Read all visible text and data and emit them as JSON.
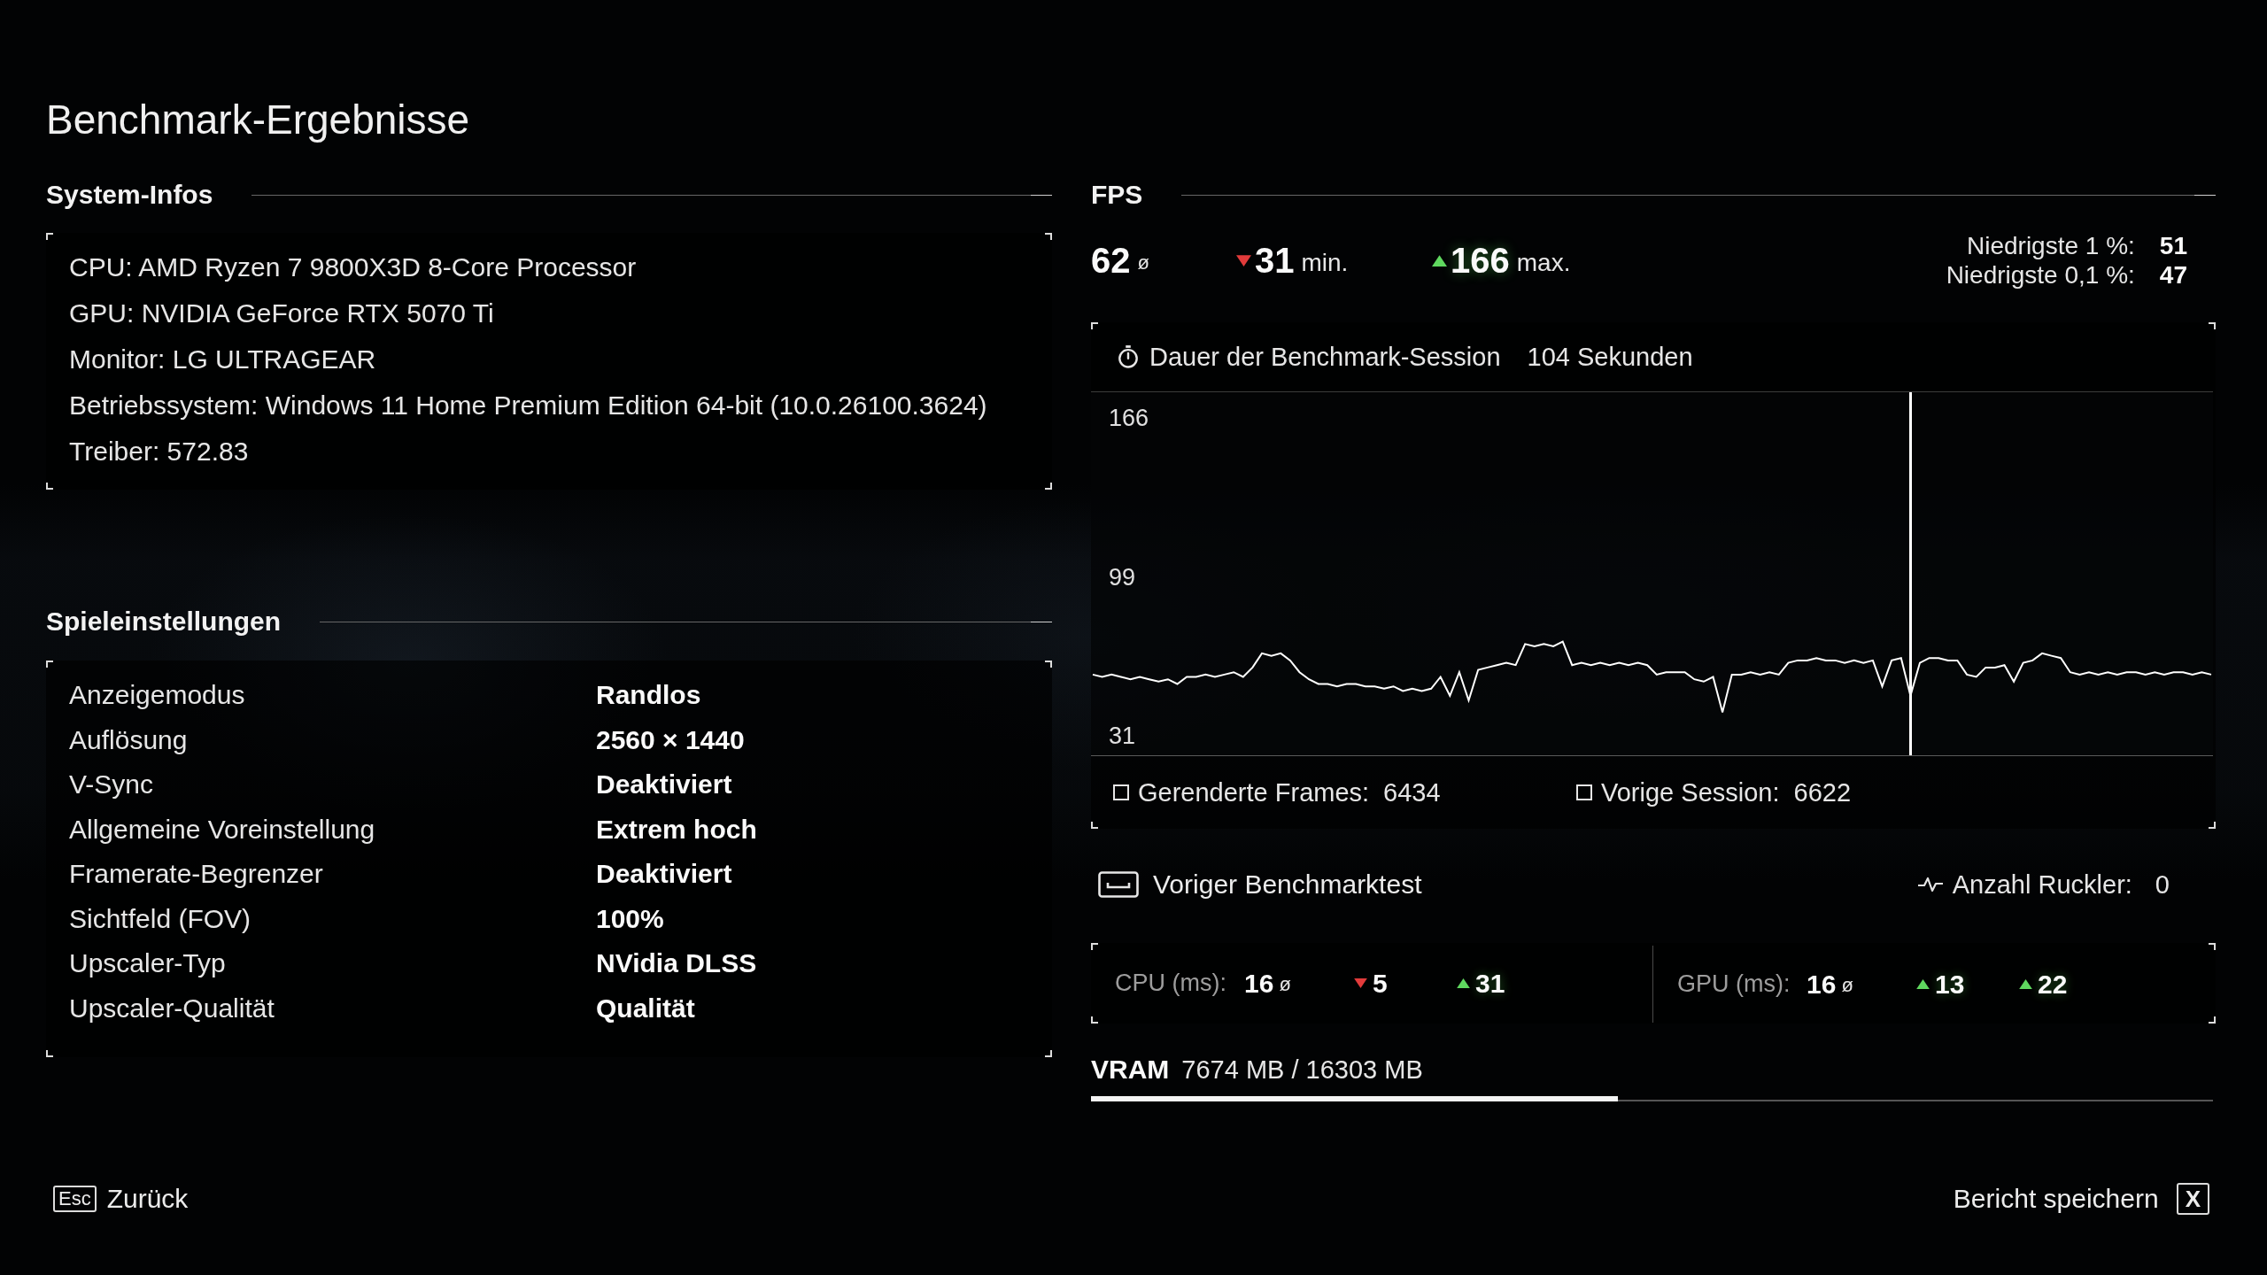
{
  "title": "Benchmark-Ergebnisse",
  "system_info": {
    "heading": "System-Infos",
    "items": [
      "CPU: AMD Ryzen 7 9800X3D 8-Core Processor",
      "GPU: NVIDIA GeForce RTX 5070 Ti",
      "Monitor: LG ULTRAGEAR",
      "Betriebssystem: Windows 11 Home Premium Edition 64-bit (10.0.26100.3624)",
      "Treiber: 572.83"
    ]
  },
  "game_settings": {
    "heading": "Spieleinstellungen",
    "rows": [
      {
        "label": "Anzeigemodus",
        "value": "Randlos"
      },
      {
        "label": "Auflösung",
        "value": "2560 × 1440"
      },
      {
        "label": "V-Sync",
        "value": "Deaktiviert"
      },
      {
        "label": "Allgemeine Voreinstellung",
        "value": "Extrem hoch"
      },
      {
        "label": "Framerate-Begrenzer",
        "value": "Deaktiviert"
      },
      {
        "label": "Sichtfeld (FOV)",
        "value": "100%"
      },
      {
        "label": "Upscaler-Typ",
        "value": "NVidia DLSS"
      },
      {
        "label": "Upscaler-Qualität",
        "value": "Qualität"
      }
    ]
  },
  "fps": {
    "heading": "FPS",
    "stats": [
      {
        "kind": "avg",
        "value": "62",
        "unit": "ø"
      },
      {
        "kind": "down",
        "value": "31",
        "unit": "min."
      },
      {
        "kind": "up",
        "value": "166",
        "unit": "max."
      }
    ],
    "lows": [
      {
        "label": "Niedrigste 1 %:",
        "value": "51"
      },
      {
        "label": "Niedrigste 0,1 %:",
        "value": "47"
      }
    ],
    "session": {
      "label": "Dauer der Benchmark-Session",
      "value": "104 Sekunden"
    },
    "graph": {
      "scale_labels": [
        "166",
        "99",
        "31"
      ]
    },
    "frames": [
      {
        "label": "Gerenderte Frames:",
        "value": "6434"
      },
      {
        "label": "Vorige Session:",
        "value": "6622"
      }
    ]
  },
  "previous_benchmark": {
    "label": "Voriger Benchmarktest"
  },
  "stutters": {
    "label": "Anzahl Ruckler:",
    "value": "0"
  },
  "frame_times": [
    {
      "label": "CPU (ms):",
      "stats": [
        {
          "kind": "avg",
          "value": "16",
          "unit": "ø"
        },
        {
          "kind": "down",
          "value": "5"
        },
        {
          "kind": "up",
          "value": "31"
        }
      ]
    },
    {
      "label": "GPU (ms):",
      "stats": [
        {
          "kind": "avg",
          "value": "16",
          "unit": "ø"
        },
        {
          "kind": "up",
          "value": "13"
        },
        {
          "kind": "up",
          "value": "22"
        }
      ]
    }
  ],
  "vram": {
    "label": "VRAM",
    "value": "7674 MB / 16303 MB",
    "level": 0.47
  },
  "footer": {
    "back": {
      "key": "Esc",
      "label": "Zurück"
    },
    "save": {
      "label": "Bericht speichern",
      "key": "X"
    }
  }
}
